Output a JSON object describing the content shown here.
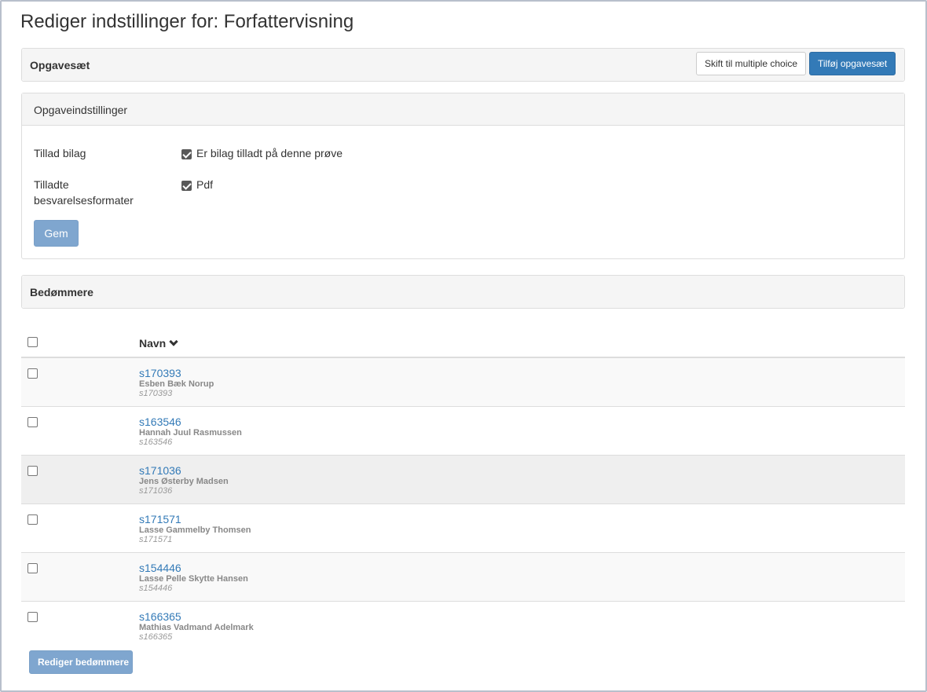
{
  "page": {
    "title": "Rediger indstillinger for: Forfattervisning"
  },
  "opgavesaet": {
    "title": "Opgavesæt",
    "switch_button": "Skift til multiple choice",
    "add_button": "Tilføj opgavesæt"
  },
  "settings": {
    "title": "Opgaveindstillinger",
    "allow_attachments_label": "Tillad bilag",
    "allow_attachments_checkbox": "Er bilag tilladt på denne prøve",
    "allow_attachments_checked": true,
    "formats_label_line1": "Tilladte",
    "formats_label_line2": "besvarelsesformater",
    "format_pdf": "Pdf",
    "format_pdf_checked": true,
    "save_button": "Gem"
  },
  "bedoemmere": {
    "title": "Bedømmere",
    "column_name": "Navn",
    "rows": [
      {
        "id": "s170393",
        "name": "Esben Bæk Norup",
        "sub": "s170393"
      },
      {
        "id": "s163546",
        "name": "Hannah Juul Rasmussen",
        "sub": "s163546"
      },
      {
        "id": "s171036",
        "name": "Jens Østerby Madsen",
        "sub": "s171036"
      },
      {
        "id": "s171571",
        "name": "Lasse Gammelby Thomsen",
        "sub": "s171571"
      },
      {
        "id": "s154446",
        "name": "Lasse Pelle Skytte Hansen",
        "sub": "s154446"
      },
      {
        "id": "s166365",
        "name": "Mathias Vadmand Adelmark",
        "sub": "s166365"
      }
    ],
    "edit_button": "Rediger bedømmere"
  },
  "colors": {
    "primary": "#337ab7",
    "link": "#337ab7",
    "panel_bg": "#f5f5f5"
  }
}
